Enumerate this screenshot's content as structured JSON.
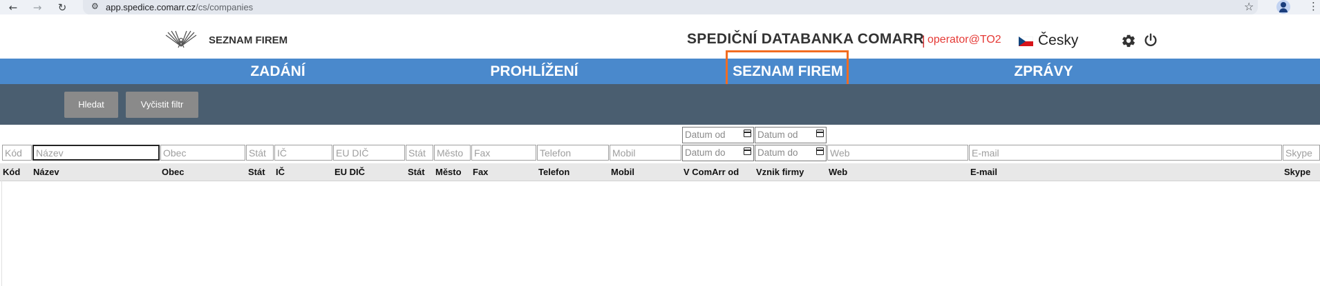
{
  "browser": {
    "url_host": "app.spedice.comarr.cz",
    "url_path": "/cs/companies"
  },
  "header": {
    "brand": "SEZNAM FIREM",
    "app_title": "SPEDIČNÍ DATABANKA COMARR",
    "separator": "|",
    "user": "operator@TO2",
    "language": "Česky"
  },
  "nav": {
    "items": [
      {
        "label": "ZADÁNÍ"
      },
      {
        "label": "PROHLÍŽENÍ"
      },
      {
        "label": "SEZNAM FIREM"
      },
      {
        "label": "ZPRÁVY"
      }
    ],
    "active": "SEZNAM FIREM"
  },
  "actions": {
    "search_label": "Hledat",
    "clear_label": "Vyčistit filtr"
  },
  "filters": {
    "date_from_1": "Datum od",
    "date_from_2": "Datum od",
    "placeholders": {
      "code": "Kód",
      "name": "Název",
      "city_obec": "Obec",
      "state1": "Stát",
      "ic": "IČ",
      "eu_dic": "EU DIČ",
      "state2": "Stát",
      "city": "Město",
      "fax": "Fax",
      "phone": "Telefon",
      "mobile": "Mobil",
      "date_to_1": "Datum do",
      "date_to_2": "Datum do",
      "web": "Web",
      "email": "E-mail",
      "skype": "Skype"
    }
  },
  "table": {
    "columns": [
      "Kód",
      "Název",
      "Obec",
      "Stát",
      "IČ",
      "EU DIČ",
      "Stát",
      "Město",
      "Fax",
      "Telefon",
      "Mobil",
      "V ComArr od",
      "Vznik firmy",
      "Web",
      "E-mail",
      "Skype"
    ]
  },
  "colors": {
    "nav_bg": "#4a89cc",
    "action_bg": "#4a5e70",
    "active_outline": "#f26c21",
    "user_text": "#e53935"
  }
}
